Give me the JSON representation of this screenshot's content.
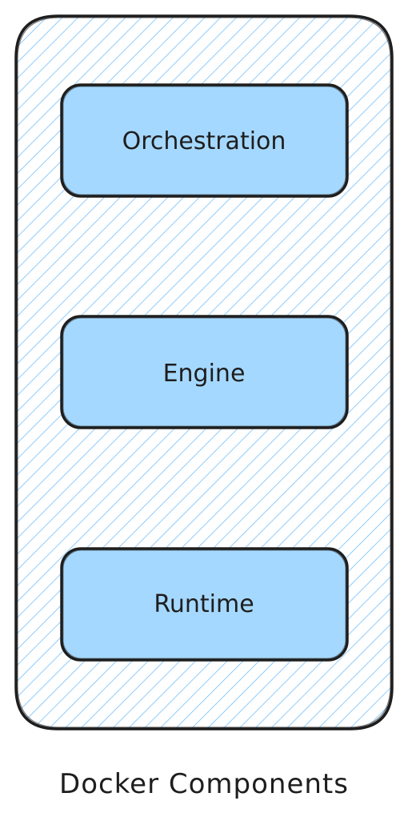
{
  "diagram": {
    "caption": "Docker Components",
    "components": [
      {
        "label": "Orchestration"
      },
      {
        "label": "Engine"
      },
      {
        "label": "Runtime"
      }
    ]
  },
  "colors": {
    "stroke": "#1e1e1e",
    "box_fill": "#a5d8ff",
    "hatch": "#74c0fc",
    "background": "#ffffff"
  }
}
